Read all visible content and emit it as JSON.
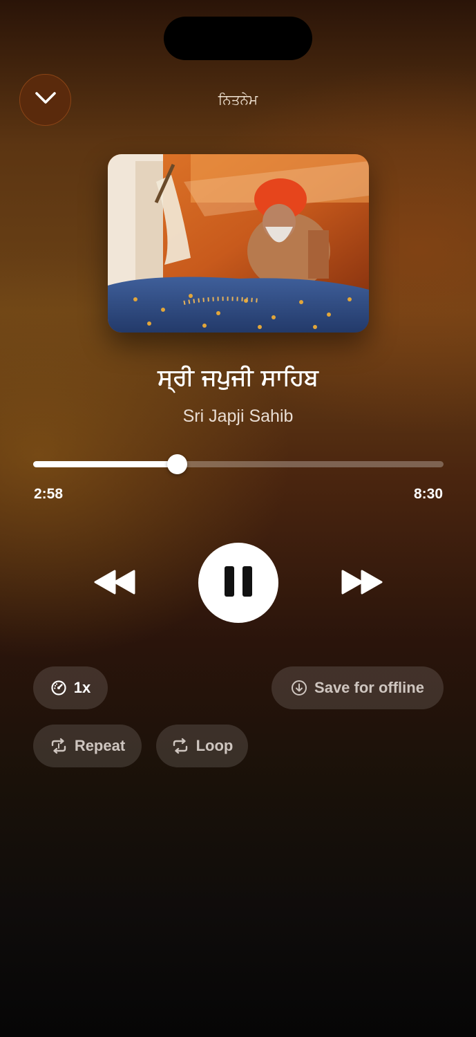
{
  "header": {
    "title": "ਨਿਤਨੇਮ",
    "collapse_icon": "chevron-down-icon"
  },
  "track": {
    "title": "ਸ੍ਰੀ ਜਪੁਜੀ ਸਾਹਿਬ",
    "subtitle": "Sri Japji Sahib"
  },
  "playback": {
    "elapsed": "2:58",
    "total": "8:30",
    "progress_fraction": 0.35,
    "state": "playing",
    "rewind_icon": "rewind-icon",
    "pause_icon": "pause-icon",
    "forward_icon": "fast-forward-icon"
  },
  "options": {
    "speed_label": "1x",
    "speed_icon": "speedometer-icon",
    "save_label": "Save for offline",
    "save_icon": "download-circle-icon",
    "repeat_label": "Repeat",
    "repeat_icon": "repeat-one-icon",
    "loop_label": "Loop",
    "loop_icon": "loop-icon"
  }
}
